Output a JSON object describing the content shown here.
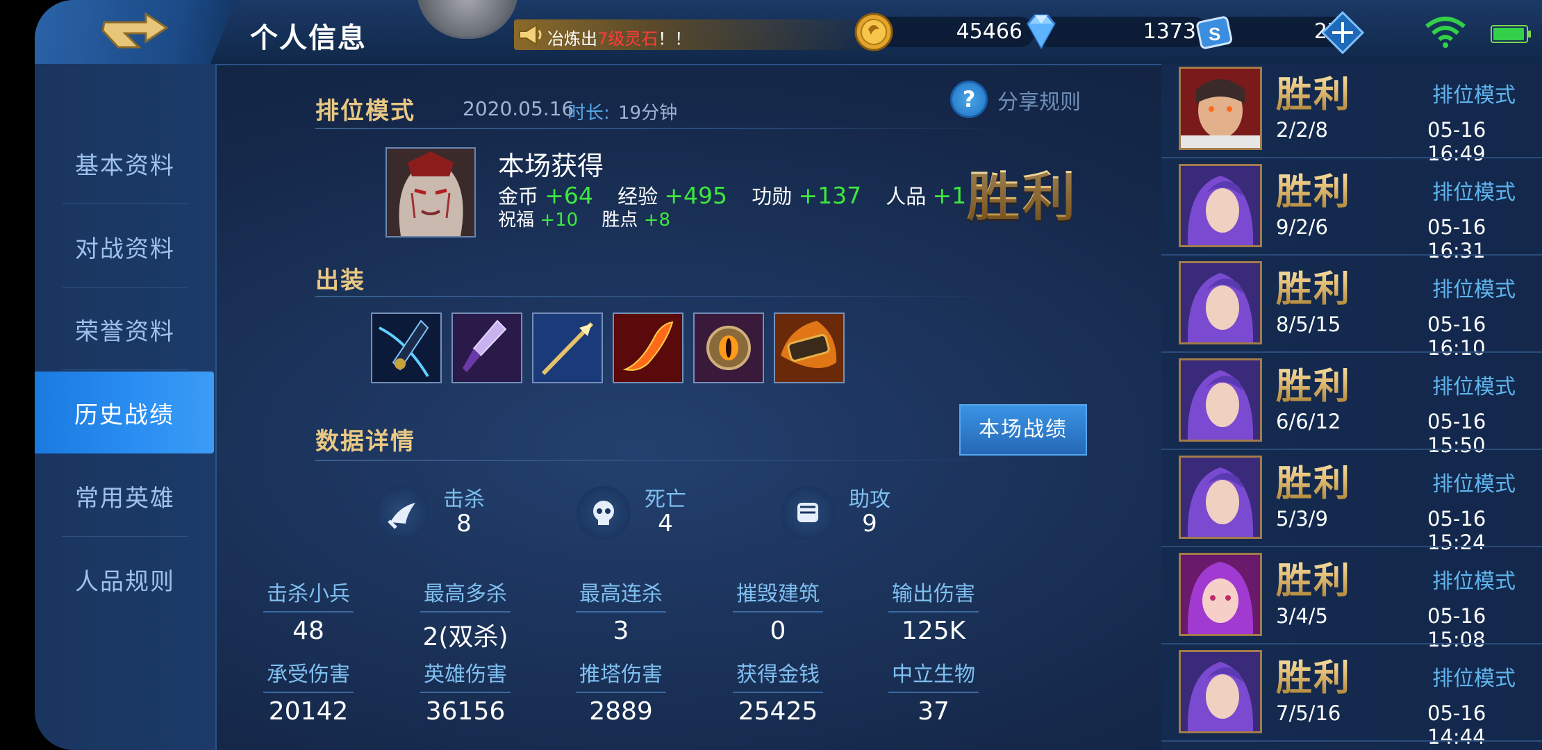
{
  "header": {
    "title": "个人信息",
    "announcement": {
      "prefix": "冶炼出",
      "highlight": "7级灵石",
      "suffix": "！！"
    },
    "gold": "45466",
    "diamonds": "1373",
    "tickets": "27"
  },
  "sidebar": {
    "items": [
      {
        "label": "基本资料"
      },
      {
        "label": "对战资料"
      },
      {
        "label": "荣誉资料"
      },
      {
        "label": "历史战绩",
        "active": true
      },
      {
        "label": "常用英雄"
      },
      {
        "label": "人品规则"
      }
    ]
  },
  "match": {
    "mode": "排位模式",
    "date": "2020.05.16",
    "duration_label": "时长:",
    "duration": "19分钟",
    "share_rules": "分享规则",
    "earn_title": "本场获得",
    "rewards": {
      "gold_label": "金币",
      "gold": "+64",
      "exp_label": "经验",
      "exp": "+495",
      "merit_label": "功勋",
      "merit": "+137",
      "karma_label": "人品",
      "karma": "+1",
      "blessing_label": "祝福",
      "blessing": "+10",
      "winpoint_label": "胜点",
      "winpoint": "+8"
    },
    "result": "胜利",
    "equipment_title": "出装",
    "equipment_icons": [
      "shadow-blade-icon",
      "purple-dagger-icon",
      "golden-spear-icon",
      "flame-blade-icon",
      "eye-shield-icon",
      "fire-cannon-icon"
    ],
    "stats_title": "数据详情",
    "match_stats_button": "本场战绩",
    "kda": [
      {
        "label": "击杀",
        "value": "8",
        "icon": "sword-icon"
      },
      {
        "label": "死亡",
        "value": "4",
        "icon": "skull-icon"
      },
      {
        "label": "助攻",
        "value": "9",
        "icon": "fist-icon"
      }
    ],
    "stats_row1": [
      {
        "label": "击杀小兵",
        "value": "48"
      },
      {
        "label": "最高多杀",
        "value": "2(双杀)"
      },
      {
        "label": "最高连杀",
        "value": "3"
      },
      {
        "label": "摧毁建筑",
        "value": "0"
      },
      {
        "label": "输出伤害",
        "value": "125K"
      }
    ],
    "stats_row2": [
      {
        "label": "承受伤害",
        "value": "20142"
      },
      {
        "label": "英雄伤害",
        "value": "36156"
      },
      {
        "label": "推塔伤害",
        "value": "2889"
      },
      {
        "label": "获得金钱",
        "value": "25425"
      },
      {
        "label": "中立生物",
        "value": "37"
      }
    ]
  },
  "history": [
    {
      "result": "胜利",
      "mode": "排位模式",
      "kda": "2/2/8",
      "time": "05-16 16:49"
    },
    {
      "result": "胜利",
      "mode": "排位模式",
      "kda": "9/2/6",
      "time": "05-16 16:31"
    },
    {
      "result": "胜利",
      "mode": "排位模式",
      "kda": "8/5/15",
      "time": "05-16 16:10"
    },
    {
      "result": "胜利",
      "mode": "排位模式",
      "kda": "6/6/12",
      "time": "05-16 15:50"
    },
    {
      "result": "胜利",
      "mode": "排位模式",
      "kda": "5/3/9",
      "time": "05-16 15:24"
    },
    {
      "result": "胜利",
      "mode": "排位模式",
      "kda": "3/4/5",
      "time": "05-16 15:08"
    },
    {
      "result": "胜利",
      "mode": "排位模式",
      "kda": "7/5/16",
      "time": "05-16 14:44"
    }
  ]
}
